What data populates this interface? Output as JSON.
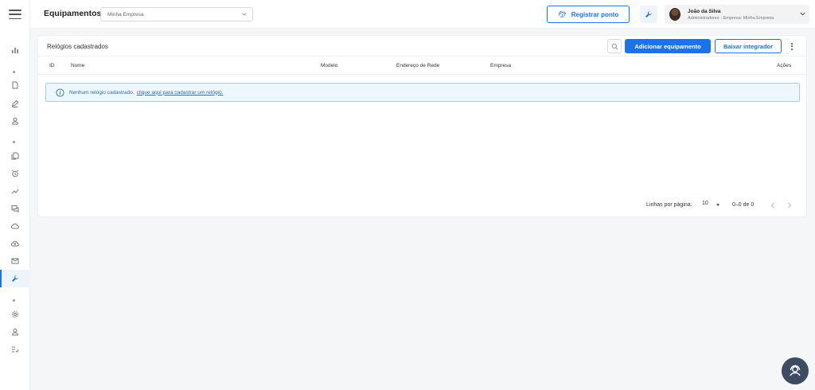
{
  "header": {
    "title": "Equipamentos",
    "company_select": "Minha Empresa",
    "register_button": "Registrar ponto",
    "user": {
      "name": "João da Silva",
      "role": "Administradores - Empresa: Minha Empresa"
    }
  },
  "sidebar": {
    "icons": [
      "dashboard-icon",
      "document-icon",
      "pen-icon",
      "user-icon",
      "files-icon",
      "alarm-icon",
      "chart-line-icon",
      "chat-icon",
      "cloud-icon",
      "cloud-upload-icon",
      "mail-icon",
      "wrench-icon",
      "gear-icon",
      "person-icon",
      "checklist-icon"
    ],
    "active": "wrench-icon"
  },
  "card": {
    "title": "Relógios cadastrados",
    "add_button": "Adicionar equipamento",
    "download_button": "Baixar integrador",
    "columns": [
      "ID",
      "Nome",
      "Modelo",
      "Endereço de Rede",
      "Empresa",
      "Ações"
    ],
    "empty_message": "Nenhum relógio cadastrado.",
    "empty_link": "clique aqui para cadastrar um relógio."
  },
  "pagination": {
    "rows_per_page_label": "Linhas por página:",
    "rows_per_page": "10",
    "range": "0–0 de 0"
  },
  "colors": {
    "primary": "#1a73e8",
    "alert_bg": "#eef7fd",
    "alert_border": "#a7cde6",
    "fab": "#3d4b63"
  }
}
